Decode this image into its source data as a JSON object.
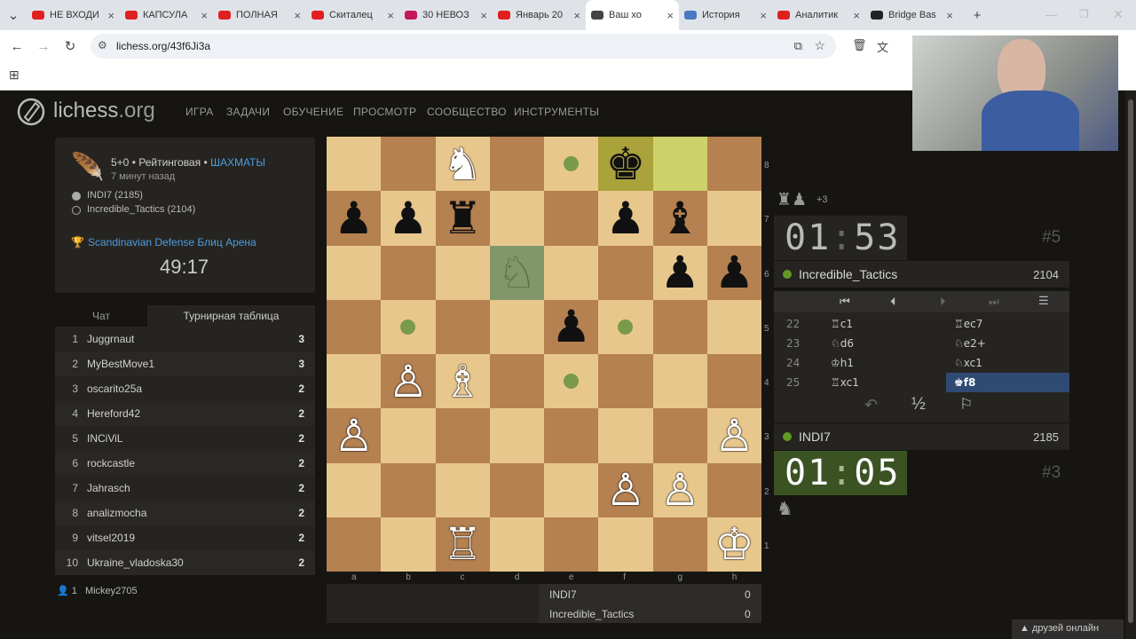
{
  "browser": {
    "tabs": [
      {
        "title": "НЕ ВХОДИ",
        "color": "#e02020"
      },
      {
        "title": "КАПСУЛА",
        "color": "#e02020"
      },
      {
        "title": "ПОЛНАЯ",
        "color": "#e02020"
      },
      {
        "title": "Скиталец",
        "color": "#e02020"
      },
      {
        "title": "30 НЕВОЗ",
        "color": "#c2185b"
      },
      {
        "title": "Январь 20",
        "color": "#e02020"
      },
      {
        "title": "Ваш хо",
        "color": "#444",
        "active": true
      },
      {
        "title": "История",
        "color": "#4a78c2"
      },
      {
        "title": "Аналитик",
        "color": "#e02020"
      },
      {
        "title": "Bridge Bas",
        "color": "#222"
      }
    ],
    "url": "lichess.org/43f6Ji3a"
  },
  "header": {
    "logo_main": "lichess",
    "logo_tld": ".org",
    "nav": [
      "ИГРА",
      "ЗАДАЧИ",
      "ОБУЧЕНИЕ",
      "ПРОСМОТР",
      "СООБЩЕСТВО",
      "ИНСТРУМЕНТЫ"
    ]
  },
  "game_meta": {
    "mode": "5+0 • Рейтинговая • ",
    "variant": "ШАХМАТЫ",
    "ago": "7 минут назад",
    "white": "INDI7 (2185)",
    "black": "Incredible_Tactics (2104)",
    "tournament": "Scandinavian Defense Блиц Арена",
    "tournament_clock": "49:17"
  },
  "side_tabs": {
    "chat": "Чат",
    "standings": "Турнирная таблица"
  },
  "standings": [
    {
      "rank": "1",
      "name": "Juggrnaut",
      "pts": "3"
    },
    {
      "rank": "2",
      "name": "MyBestMove1",
      "pts": "3"
    },
    {
      "rank": "3",
      "name": "oscarito25a",
      "pts": "2"
    },
    {
      "rank": "4",
      "name": "Hereford42",
      "pts": "2"
    },
    {
      "rank": "5",
      "name": "INCiViL",
      "pts": "2"
    },
    {
      "rank": "6",
      "name": "rockcastle",
      "pts": "2"
    },
    {
      "rank": "7",
      "name": "Jahrasch",
      "pts": "2"
    },
    {
      "rank": "8",
      "name": "analizmocha",
      "pts": "2"
    },
    {
      "rank": "9",
      "name": "vitsel2019",
      "pts": "2"
    },
    {
      "rank": "10",
      "name": "Ukraine_vladoska30",
      "pts": "2"
    }
  ],
  "spectators": {
    "count": "1",
    "name": "Mickey2705"
  },
  "board": {
    "files": [
      "a",
      "b",
      "c",
      "d",
      "e",
      "f",
      "g",
      "h"
    ],
    "ranks": [
      "8",
      "7",
      "6",
      "5",
      "4",
      "3",
      "2",
      "1"
    ],
    "pieces": [
      {
        "sq": "c8",
        "glyph": "♞",
        "side": "w"
      },
      {
        "sq": "f8",
        "glyph": "♚",
        "side": "b"
      },
      {
        "sq": "a7",
        "glyph": "♟",
        "side": "b"
      },
      {
        "sq": "b7",
        "glyph": "♟",
        "side": "b"
      },
      {
        "sq": "c7",
        "glyph": "♜",
        "side": "b"
      },
      {
        "sq": "f7",
        "glyph": "♟",
        "side": "b"
      },
      {
        "sq": "g7",
        "glyph": "♝",
        "side": "b"
      },
      {
        "sq": "g6",
        "glyph": "♟",
        "side": "b"
      },
      {
        "sq": "h6",
        "glyph": "♟",
        "side": "b"
      },
      {
        "sq": "e5",
        "glyph": "♟",
        "side": "b"
      },
      {
        "sq": "b4",
        "glyph": "♙",
        "side": "w"
      },
      {
        "sq": "c4",
        "glyph": "♗",
        "side": "w"
      },
      {
        "sq": "a3",
        "glyph": "♙",
        "side": "w"
      },
      {
        "sq": "h3",
        "glyph": "♙",
        "side": "w"
      },
      {
        "sq": "f2",
        "glyph": "♙",
        "side": "w"
      },
      {
        "sq": "g2",
        "glyph": "♙",
        "side": "w"
      },
      {
        "sq": "c1",
        "glyph": "♖",
        "side": "w"
      },
      {
        "sq": "h1",
        "glyph": "♔",
        "side": "w"
      }
    ],
    "ghost": {
      "sq": "d6",
      "glyph": "♘"
    },
    "dots": [
      "e8",
      "b5",
      "f5",
      "e4"
    ],
    "highlights": [
      {
        "sq": "f8",
        "color": "#aaa23a"
      },
      {
        "sq": "g8",
        "color": "#cdd26a"
      },
      {
        "sq": "d6",
        "color": "#829769"
      }
    ]
  },
  "score": [
    {
      "name": "INDI7",
      "pts": "0"
    },
    {
      "name": "Incredible_Tactics",
      "pts": "0"
    }
  ],
  "top_player": {
    "material": "+3",
    "clock_min": "01",
    "clock_sec": "53",
    "name": "Incredible_Tactics",
    "rating": "2104",
    "rank": "#5"
  },
  "moves": [
    {
      "n": "22",
      "w": "♖c1",
      "b": "♖ec7"
    },
    {
      "n": "23",
      "w": "♘d6",
      "b": "♘e2+"
    },
    {
      "n": "24",
      "w": "♔h1",
      "b": "♘xc1"
    },
    {
      "n": "25",
      "w": "♖xc1",
      "b": "♚f8"
    }
  ],
  "bottom_player": {
    "clock_min": "01",
    "clock_sec": "05",
    "name": "INDI7",
    "rating": "2185",
    "rank": "#3"
  },
  "footer_online": "▲ друзей онлайн"
}
